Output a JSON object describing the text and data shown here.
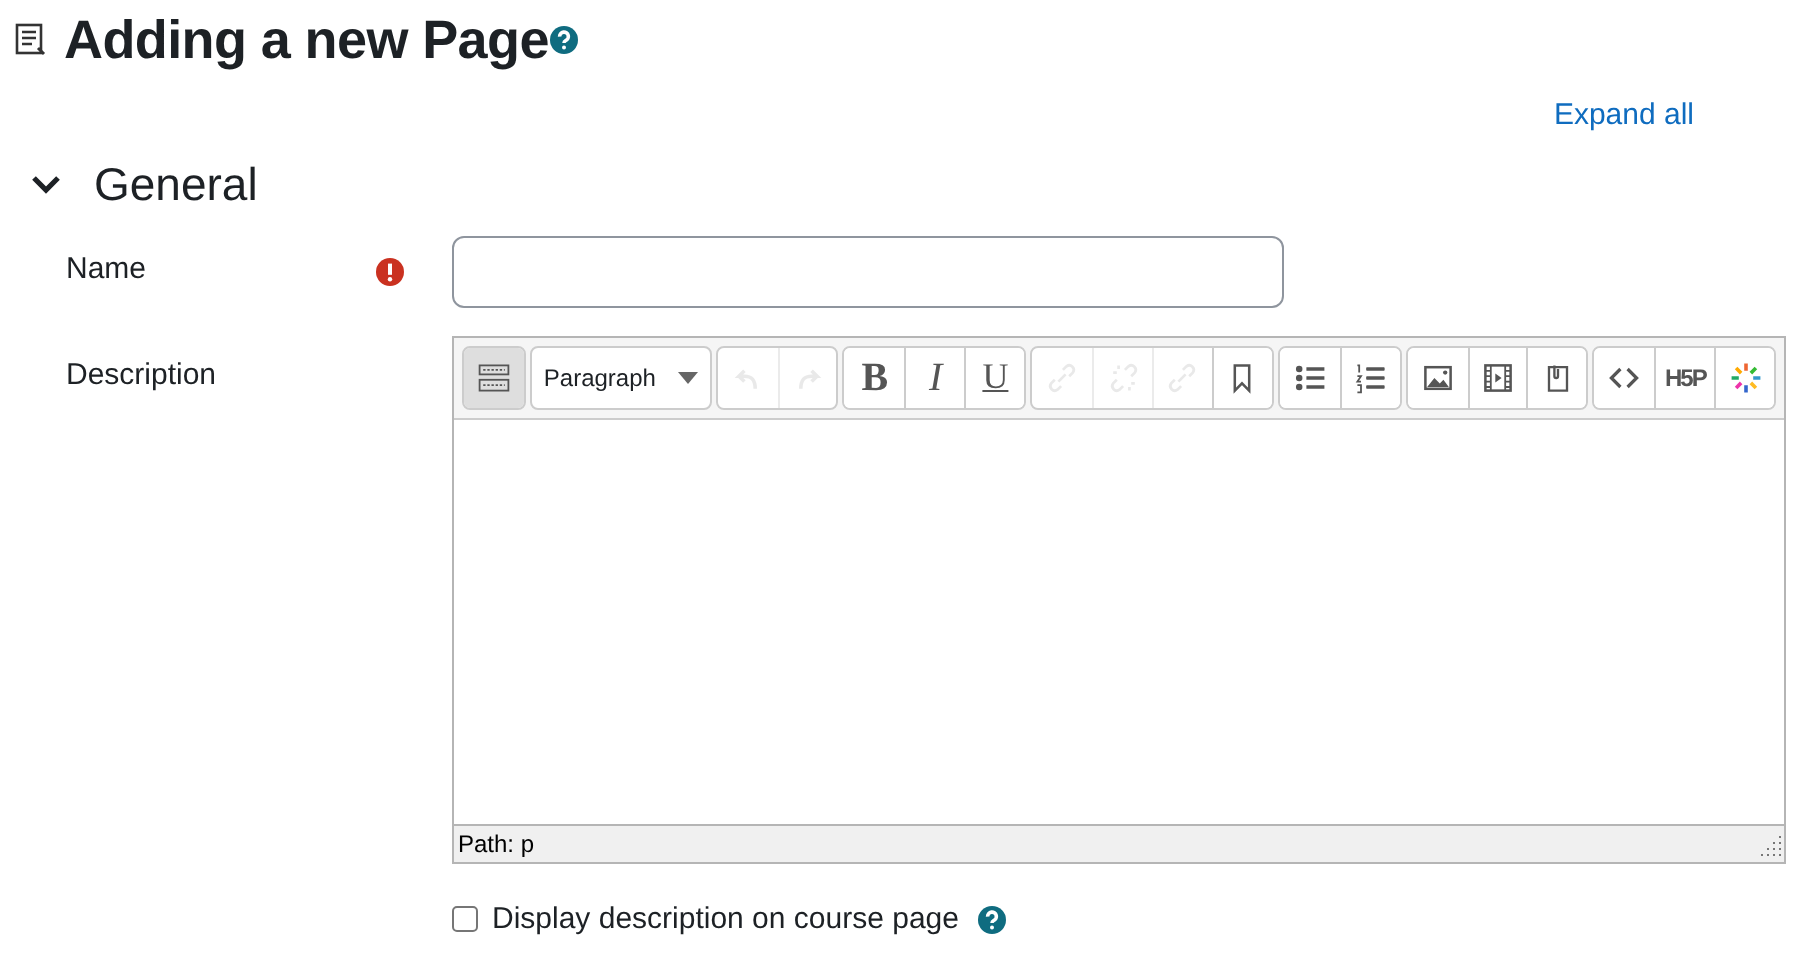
{
  "page": {
    "title": "Adding a new Page",
    "expand_all": "Expand all"
  },
  "section": {
    "title": "General",
    "expanded": true
  },
  "name_field": {
    "label": "Name",
    "required": true
  },
  "description": {
    "label": "Description",
    "paragraph_select": "Paragraph",
    "path": "Path: p",
    "toolbar_groups": [
      [
        {
          "kind": "icon",
          "pressed": true,
          "disabled": false
        }
      ],
      [
        {
          "kind": "select"
        }
      ],
      [
        {
          "kind": "icon",
          "pressed": false,
          "disabled": true
        },
        {
          "kind": "icon",
          "pressed": false,
          "disabled": true
        }
      ],
      [
        {
          "kind": "text",
          "label": "B",
          "pressed": false,
          "disabled": false
        },
        {
          "kind": "text",
          "label": "I",
          "pressed": false,
          "disabled": false
        },
        {
          "kind": "text",
          "label": "U",
          "pressed": false,
          "disabled": false
        }
      ],
      [
        {
          "kind": "icon",
          "pressed": false,
          "disabled": true
        },
        {
          "kind": "icon",
          "pressed": false,
          "disabled": true
        },
        {
          "kind": "icon",
          "pressed": false,
          "disabled": true
        },
        {
          "kind": "icon",
          "pressed": false,
          "disabled": false
        }
      ],
      [
        {
          "kind": "icon",
          "pressed": false,
          "disabled": false
        },
        {
          "kind": "icon",
          "pressed": false,
          "disabled": false
        }
      ],
      [
        {
          "kind": "icon",
          "pressed": false,
          "disabled": false
        },
        {
          "kind": "icon",
          "pressed": false,
          "disabled": false
        },
        {
          "kind": "icon",
          "pressed": false,
          "disabled": false
        }
      ],
      [
        {
          "kind": "icon",
          "pressed": false,
          "disabled": false
        },
        {
          "kind": "text",
          "label": "H5P",
          "pressed": false,
          "disabled": false
        },
        {
          "kind": "icon",
          "pressed": false,
          "disabled": false
        }
      ]
    ]
  },
  "display_option": {
    "label": "Display description on course page",
    "checked": false
  }
}
